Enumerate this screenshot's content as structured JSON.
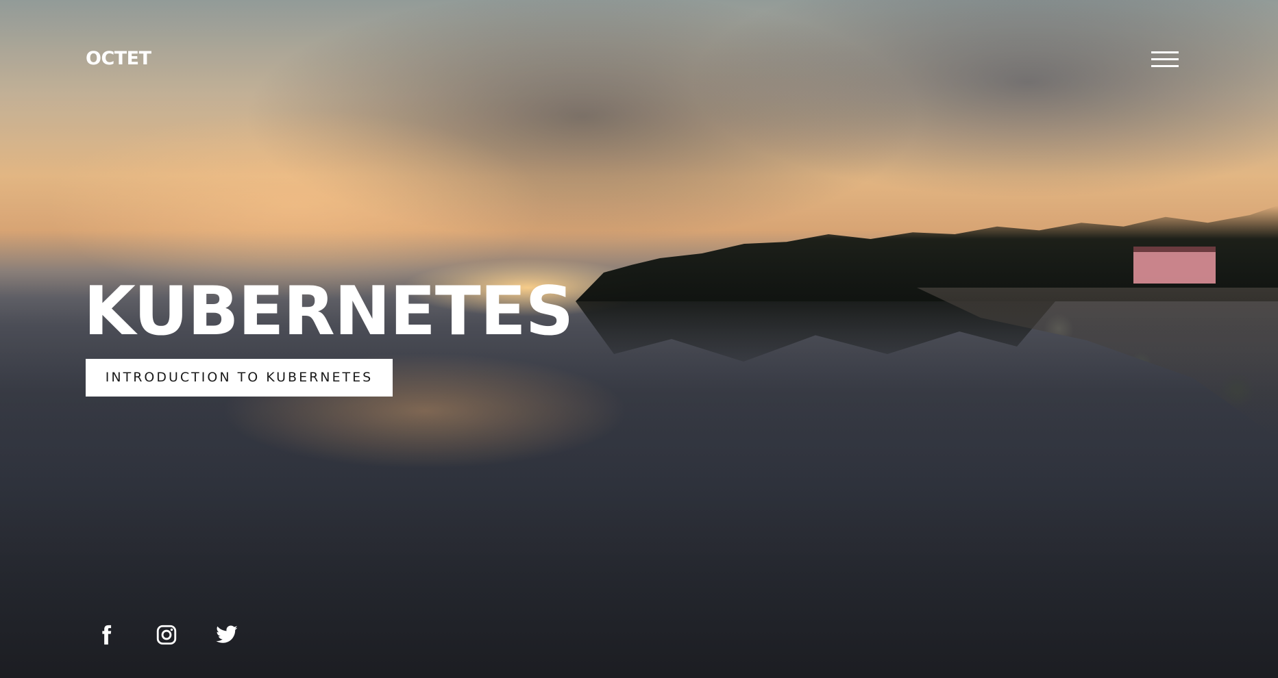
{
  "brand": {
    "logo_text": "OCTET"
  },
  "header": {
    "menu_icon": "hamburger-menu-icon"
  },
  "hero": {
    "title": "KUBERNETES",
    "cta_label": "INTRODUCTION TO KUBERNETES",
    "background": "sunset-beach-reflection-photo"
  },
  "socials": [
    {
      "name": "facebook",
      "icon": "facebook-icon"
    },
    {
      "name": "instagram",
      "icon": "instagram-icon"
    },
    {
      "name": "twitter",
      "icon": "twitter-icon"
    }
  ],
  "colors": {
    "text": "#ffffff",
    "button_bg": "#ffffff",
    "button_text": "#1a1a1a"
  }
}
